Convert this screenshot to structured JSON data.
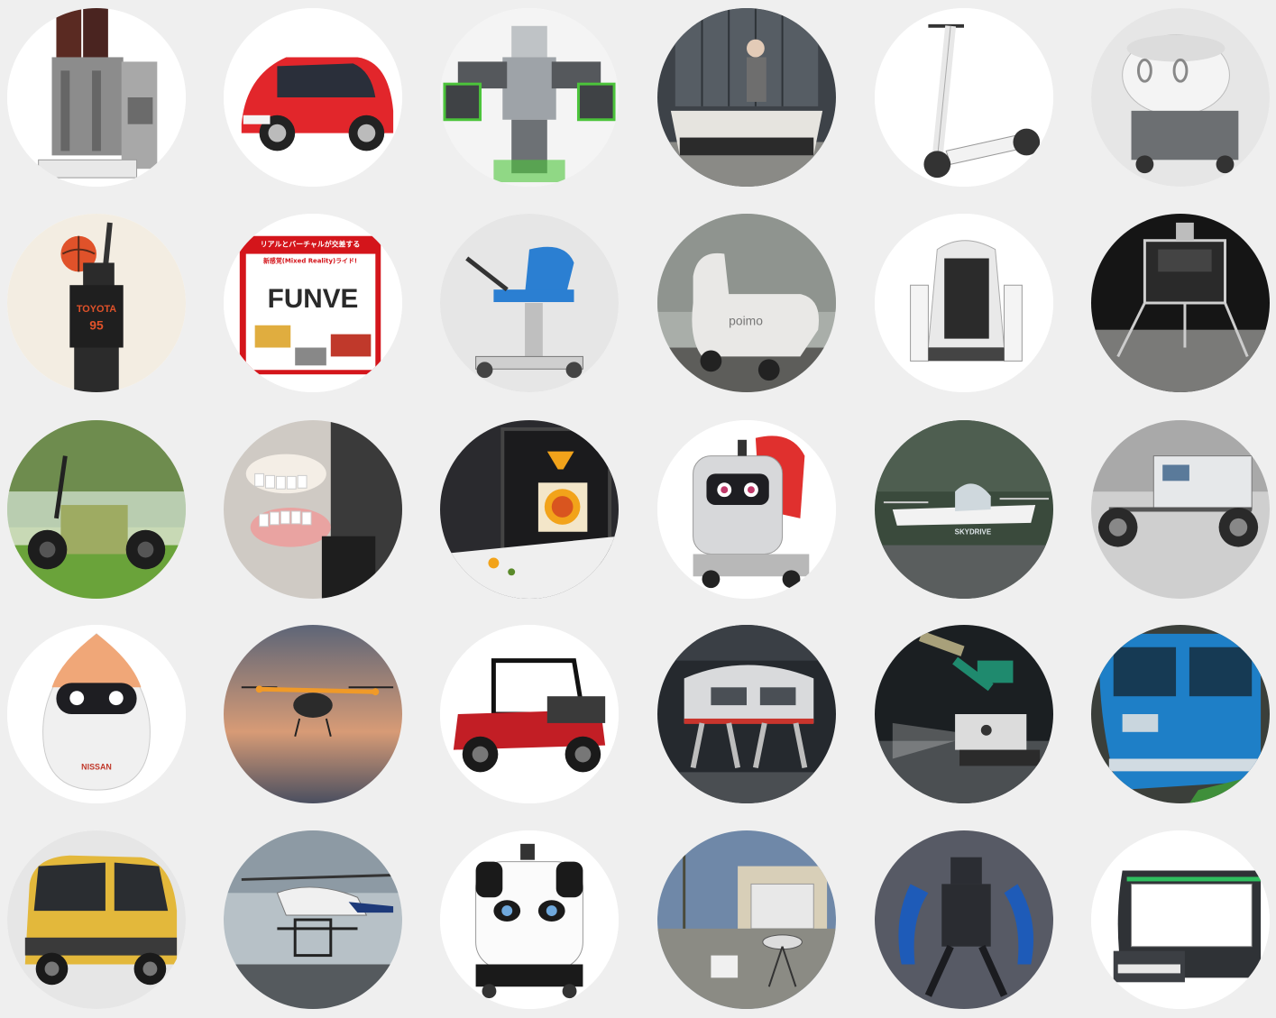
{
  "gallery": {
    "background": "#efefef",
    "rows": 5,
    "columns": 6,
    "items": [
      {
        "name": "beverage-dispenser-machine",
        "bg": "#ffffff"
      },
      {
        "name": "red-micro-ev-car",
        "bg": "#ffffff",
        "accent": "#e2262b"
      },
      {
        "name": "humanoid-robot-arms",
        "bg": "#ffffff",
        "accent": "#4cc43b"
      },
      {
        "name": "bench-mobility-with-woman",
        "bg": "#3d4248"
      },
      {
        "name": "electric-kick-scooter",
        "bg": "#ffffff"
      },
      {
        "name": "rice-cooker-robot",
        "bg": "#d7d7d7"
      },
      {
        "name": "basketball-robot",
        "bg": "#f3ede2",
        "text": "TOYOTA",
        "accent": "#e0522a"
      },
      {
        "name": "funve-ride-poster",
        "bg": "#ffffff",
        "title": "FUNVE",
        "caption1": "リアルとバーチャルが交差する",
        "caption2": "新感覚(Mixed Reality)ライド!",
        "accent": "#d4151b"
      },
      {
        "name": "mobility-chair-blue",
        "bg": "#e6e6e6",
        "accent": "#2b7fd2"
      },
      {
        "name": "poimo-inflatable-wheelchair",
        "bg": "#b8b8b0",
        "text": "poimo"
      },
      {
        "name": "single-seat-pod-mobility",
        "bg": "#ffffff"
      },
      {
        "name": "lunar-lander",
        "bg": "#1d1d1d"
      },
      {
        "name": "folding-ebike-grass",
        "bg": "#9fc27e",
        "accent": "#9eab62"
      },
      {
        "name": "dental-robot-jaw",
        "bg": "#c8c4c0"
      },
      {
        "name": "food-3d-printer",
        "bg": "#2a2a2e",
        "accent": "#f2a31a"
      },
      {
        "name": "delivery-robot-red-seat",
        "bg": "#ffffff",
        "accent": "#e0302e"
      },
      {
        "name": "skydrive-flying-car",
        "bg": "#2f3a33",
        "text": "SKYDRIVE"
      },
      {
        "name": "lunar-rover",
        "bg": "#c9c9c9"
      },
      {
        "name": "nissan-egg-robot",
        "bg": "#ffffff",
        "text": "NISSAN",
        "accent": "#f0a778"
      },
      {
        "name": "evtol-air-taxi",
        "bg": "#6a6e7a",
        "accent": "#f09a28"
      },
      {
        "name": "utility-side-by-side-vehicle",
        "bg": "#ffffff",
        "accent": "#c21e25"
      },
      {
        "name": "walking-capsule-vehicle",
        "bg": "#2a2e33",
        "accent": "#c9352d"
      },
      {
        "name": "lunar-excavator-robot",
        "bg": "#1b1f22",
        "accent": "#1f8a6e"
      },
      {
        "name": "blue-hydrogen-train",
        "bg": "#3b3f3a",
        "accent": "#1e7fc7"
      },
      {
        "name": "yellow-mini-ev",
        "bg": "#e6e6e6",
        "accent": "#e3b83b"
      },
      {
        "name": "unmanned-helicopter",
        "bg": "#9aa7b1"
      },
      {
        "name": "panda-delivery-robot",
        "bg": "#ffffff"
      },
      {
        "name": "antenna-field-equipment",
        "bg": "#6f88a8"
      },
      {
        "name": "mech-exoskeleton-robot",
        "bg": "#5a5d6a",
        "accent": "#1e5bb8"
      },
      {
        "name": "autonomous-pod-shuttle",
        "bg": "#ffffff",
        "accent": "#2fbf5f"
      }
    ]
  }
}
